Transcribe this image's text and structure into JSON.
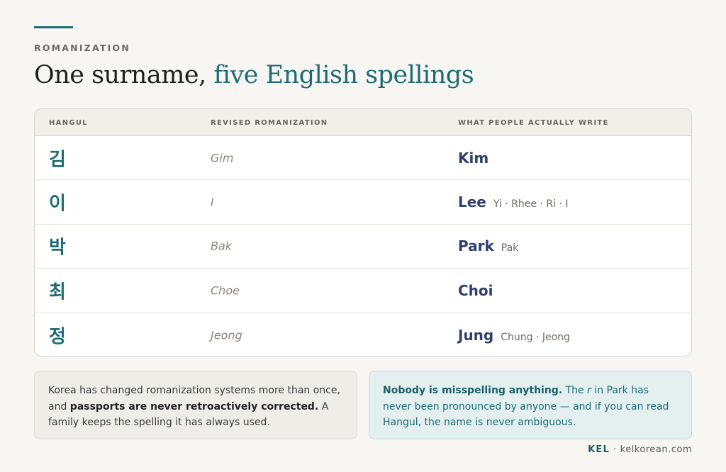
{
  "eyebrow": "ROMANIZATION",
  "headline": {
    "prefix": "One surname, ",
    "accent": "five English spellings"
  },
  "table": {
    "headers": {
      "hangul": "HANGUL",
      "revised": "REVISED ROMANIZATION",
      "written": "WHAT PEOPLE ACTUALLY WRITE"
    },
    "rows": [
      {
        "hangul": "김",
        "revised": "Gim",
        "main": "Kim",
        "variants": ""
      },
      {
        "hangul": "이",
        "revised": "I",
        "main": "Lee",
        "variants": "Yi · Rhee · Ri · I"
      },
      {
        "hangul": "박",
        "revised": "Bak",
        "main": "Park",
        "variants": "Pak"
      },
      {
        "hangul": "최",
        "revised": "Choe",
        "main": "Choi",
        "variants": ""
      },
      {
        "hangul": "정",
        "revised": "Jeong",
        "main": "Jung",
        "variants": "Chung · Jeong"
      }
    ]
  },
  "notes": {
    "left": {
      "lead": "Korea has changed romanization systems more than once, and ",
      "bold": "passports are never retroactively corrected.",
      "tail": " A family keeps the spelling it has always used."
    },
    "right": {
      "bold": "Nobody is misspelling anything.",
      "mid1": " The ",
      "italic": "r",
      "mid2": " in Park has never been pronounced by anyone — and if you can read Hangul, the name is never ambiguous."
    }
  },
  "footer": {
    "brand": "KEL",
    "separator": "·",
    "site": "kelkorean.com"
  },
  "colors": {
    "accent": "#1d6b73",
    "spelling": "#2f3f6e",
    "background": "#f8f6f2"
  }
}
